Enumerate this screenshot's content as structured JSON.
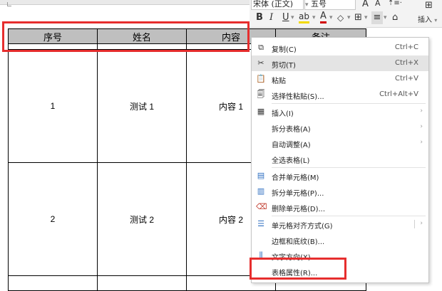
{
  "toolbar": {
    "font_name": "宋体 (正文)",
    "font_size": "五号",
    "bold": "B",
    "italic": "I",
    "underline": "U",
    "grow_font": "A",
    "shrink_font": "A",
    "insert": "插入"
  },
  "table": {
    "headers": [
      "序号",
      "姓名",
      "内容",
      "备注"
    ],
    "rows": [
      {
        "num": "1",
        "name": "测试 1",
        "content": "内容 1",
        "note": ""
      },
      {
        "num": "2",
        "name": "测试 2",
        "content": "内容 2",
        "note": ""
      }
    ]
  },
  "menu": {
    "items": [
      {
        "icon": "copy-icon",
        "label": "复制(C)",
        "shortcut": "Ctrl+C"
      },
      {
        "icon": "cut-icon",
        "label": "剪切(T)",
        "shortcut": "Ctrl+X"
      },
      {
        "icon": "paste-icon",
        "label": "粘贴",
        "shortcut": "Ctrl+V"
      },
      {
        "icon": "paste-special-icon",
        "label": "选择性粘贴(S)...",
        "shortcut": "Ctrl+Alt+V"
      },
      {
        "icon": "table-insert-icon",
        "label": "插入(I)"
      },
      {
        "label": "拆分表格(A)"
      },
      {
        "label": "自动调整(A)"
      },
      {
        "label": "全选表格(L)"
      },
      {
        "icon": "merge-cells-icon",
        "label": "合并单元格(M)"
      },
      {
        "icon": "split-cells-icon",
        "label": "拆分单元格(P)..."
      },
      {
        "icon": "delete-cells-icon",
        "label": "删除单元格(D)..."
      },
      {
        "icon": "cell-align-icon",
        "label": "单元格对齐方式(G)"
      },
      {
        "label": "边框和底纹(B)..."
      },
      {
        "icon": "text-direction-icon",
        "label": "文字方向(X)..."
      },
      {
        "label": "表格属性(R)..."
      }
    ]
  },
  "colors": {
    "highlight": "#e62e2e",
    "header_fill": "#bfbfbf",
    "hover": "#e4e4e4"
  }
}
